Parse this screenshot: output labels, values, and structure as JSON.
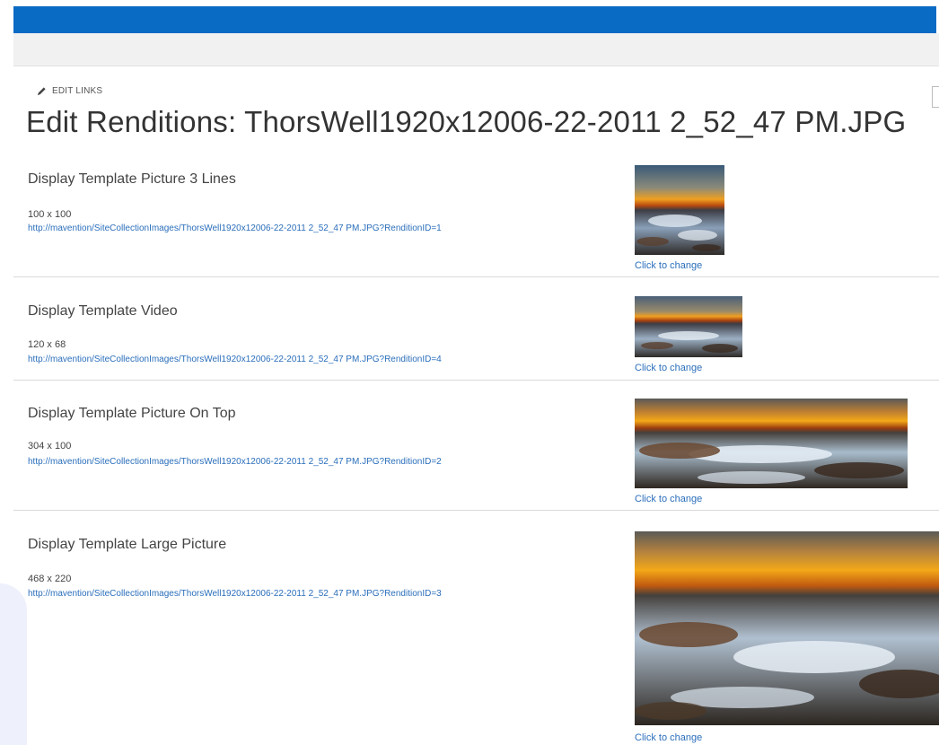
{
  "header": {
    "edit_links_label": "EDIT LINKS",
    "page_title": "Edit Renditions: ThorsWell1920x12006-22-2011 2_52_47 PM.JPG"
  },
  "renditions": [
    {
      "name": "Display Template Picture 3 Lines",
      "dimensions": "100 x 100",
      "url": "http://mavention/SiteCollectionImages/ThorsWell1920x12006-22-2011 2_52_47 PM.JPG?RenditionID=1",
      "change_label": "Click to change"
    },
    {
      "name": "Display Template Video",
      "dimensions": "120 x 68",
      "url": "http://mavention/SiteCollectionImages/ThorsWell1920x12006-22-2011 2_52_47 PM.JPG?RenditionID=4",
      "change_label": "Click to change"
    },
    {
      "name": "Display Template Picture On Top",
      "dimensions": "304 x 100",
      "url": "http://mavention/SiteCollectionImages/ThorsWell1920x12006-22-2011 2_52_47 PM.JPG?RenditionID=2",
      "change_label": "Click to change"
    },
    {
      "name": "Display Template Large Picture",
      "dimensions": "468 x 220",
      "url": "http://mavention/SiteCollectionImages/ThorsWell1920x12006-22-2011 2_52_47 PM.JPG?RenditionID=3",
      "change_label": "Click to change"
    }
  ],
  "colors": {
    "suite_bar": "#0a6bc4",
    "link": "#2a6ebb"
  }
}
